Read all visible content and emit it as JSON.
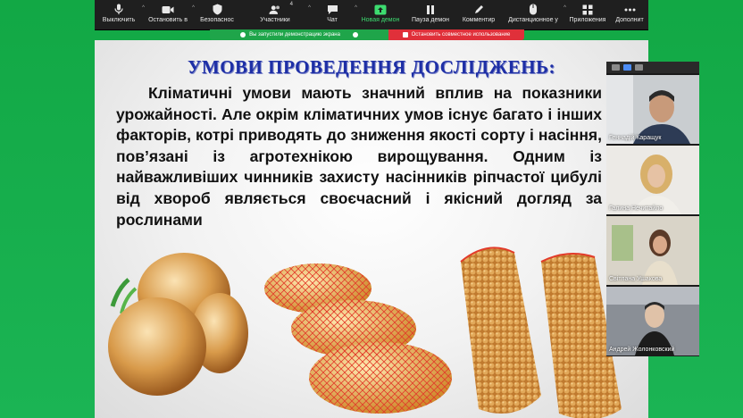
{
  "toolbar": {
    "items": [
      {
        "label": "Выключить",
        "icon": "microphone-icon"
      },
      {
        "label": "Остановить в",
        "icon": "video-camera-icon"
      },
      {
        "label": "Безопаснос",
        "icon": "shield-icon"
      },
      {
        "label": "Участники",
        "icon": "participants-icon",
        "badge": "4"
      },
      {
        "label": "Чат",
        "icon": "chat-icon"
      },
      {
        "label": "Новая демон",
        "icon": "share-screen-icon"
      },
      {
        "label": "Пауза демон",
        "icon": "pause-icon"
      },
      {
        "label": "Комментир",
        "icon": "annotate-pen-icon"
      },
      {
        "label": "Дистанционное у",
        "icon": "remote-control-icon"
      },
      {
        "label": "Приложения",
        "icon": "apps-icon"
      },
      {
        "label": "Дополнит",
        "icon": "more-icon"
      }
    ]
  },
  "share_banner": {
    "sharing_text": "Вы запустили демонстрацию экрана",
    "stop_text": "Остановить совместное использование"
  },
  "slide": {
    "title": "УМОВИ ПРОВЕДЕННЯ ДОСЛІДЖЕНЬ:",
    "body": "Кліматичні умови мають значний вплив на показники урожайності. Але окрім кліматичних умов існує багато і інших факторів, котрі приводять до зниження якості сорту і насіння, пов’язані із агротехнікою вирощування. Одним із найважливіших чинників захисту насінників ріпчастої цибулі від хвороб являється своєчасний і якісний догляд за рослинами"
  },
  "participants": [
    {
      "name": "Геннадій Каращук"
    },
    {
      "name": "Галина Нечитайло"
    },
    {
      "name": "Світлана Ушакова"
    },
    {
      "name": "Андрей Жолонковский"
    }
  ],
  "colors": {
    "toolbar_bg": "#1f1f1f",
    "title_blue": "#1e2fa6",
    "share_green": "#1fa54a",
    "stop_red": "#e0303a"
  }
}
